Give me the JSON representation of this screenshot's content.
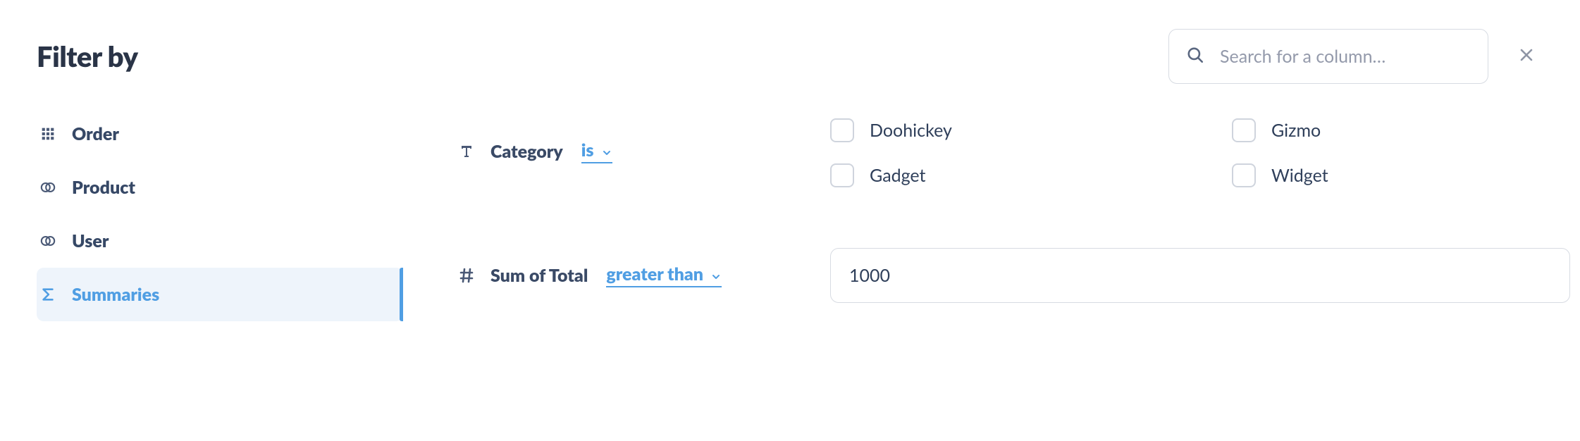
{
  "header": {
    "title": "Filter by",
    "search_placeholder": "Search for a column…"
  },
  "sidebar": {
    "items": [
      {
        "label": "Order",
        "icon": "grid-icon",
        "active": false
      },
      {
        "label": "Product",
        "icon": "join-icon",
        "active": false
      },
      {
        "label": "User",
        "icon": "join-icon",
        "active": false
      },
      {
        "label": "Summaries",
        "icon": "sigma-icon",
        "active": true
      }
    ]
  },
  "filters": {
    "category": {
      "field_label": "Category",
      "operator_label": "is",
      "options": [
        {
          "label": "Doohickey",
          "checked": false
        },
        {
          "label": "Gizmo",
          "checked": false
        },
        {
          "label": "Gadget",
          "checked": false
        },
        {
          "label": "Widget",
          "checked": false
        }
      ]
    },
    "sum_of_total": {
      "field_label": "Sum of Total",
      "operator_label": "greater than",
      "value": "1000"
    }
  }
}
